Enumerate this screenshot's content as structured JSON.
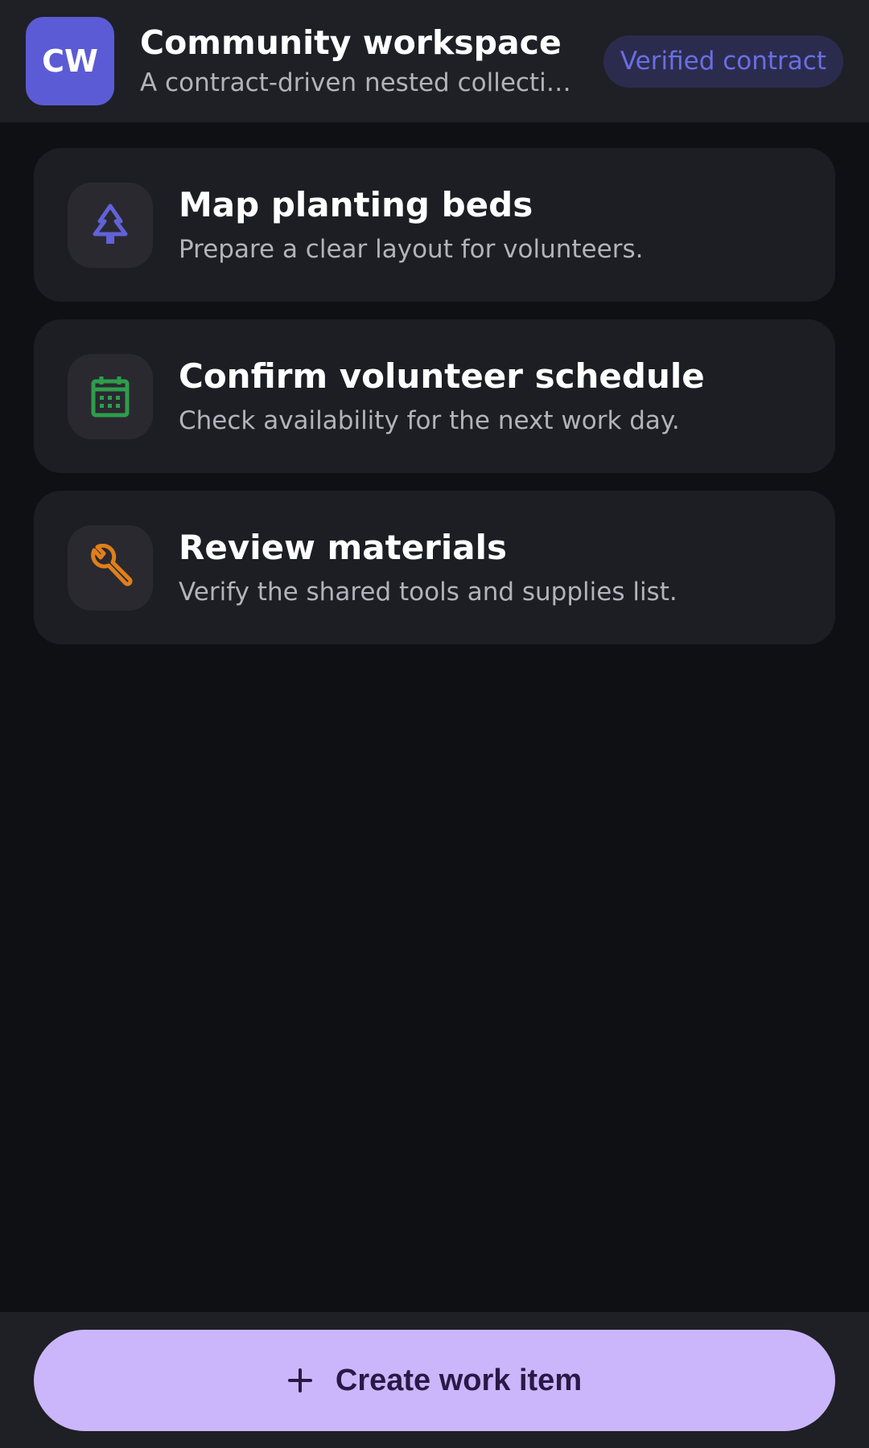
{
  "header": {
    "avatar_initials": "CW",
    "title": "Community workspace",
    "subtitle": "A contract-driven nested collection of work items for a community garden project",
    "badge": "Verified contract"
  },
  "tasks": [
    {
      "title": "Map planting beds",
      "description": "Prepare a clear layout for volunteers.",
      "icon": "tree-icon",
      "icon_color": "#6262d9"
    },
    {
      "title": "Confirm volunteer schedule",
      "description": "Check availability for the next work day.",
      "icon": "calendar-icon",
      "icon_color": "#2e9d4b"
    },
    {
      "title": "Review materials",
      "description": "Verify the shared tools and supplies list.",
      "icon": "wrench-icon",
      "icon_color": "#e07f1a"
    }
  ],
  "footer": {
    "create_button_label": "Create work item",
    "create_button_icon": "plus-icon"
  },
  "colors": {
    "background": "#0f1014",
    "surface": "#1f2025",
    "card": "#1d1e23",
    "accent": "#5b5bd6",
    "primary_button": "#cbb6fc"
  }
}
